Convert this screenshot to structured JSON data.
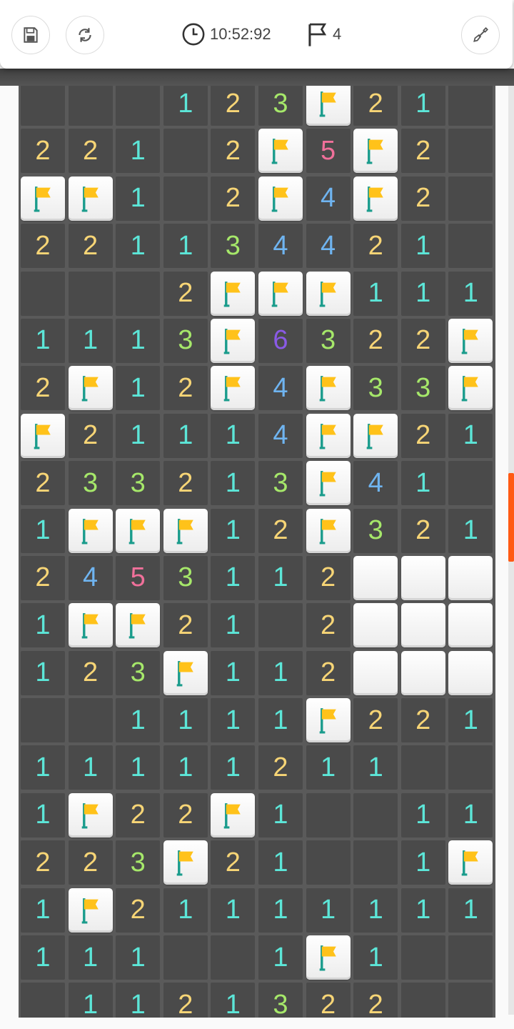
{
  "toolbar": {
    "save_icon": "save-icon",
    "restart_icon": "restart-icon",
    "timer": "10:52:92",
    "timer_icon": "clock-icon",
    "flag_count": "4",
    "flag_icon": "flag-outline-icon",
    "tool_icon": "shovel-icon"
  },
  "colors": {
    "1": "#5ce6d8",
    "2": "#f7d576",
    "3": "#a6e86a",
    "4": "#6fb4f0",
    "5": "#f0709a",
    "6": "#8a5ae6",
    "accent": "#ff5a14"
  },
  "board": {
    "rows": [
      [
        "",
        "",
        "",
        "1",
        "2",
        "3",
        "F",
        "2",
        "1",
        ""
      ],
      [
        "2",
        "2",
        "1",
        "",
        "2",
        "F",
        "5",
        "F",
        "2",
        ""
      ],
      [
        "F",
        "F",
        "1",
        "",
        "2",
        "F",
        "4",
        "F",
        "2",
        ""
      ],
      [
        "2",
        "2",
        "1",
        "1",
        "3",
        "4",
        "4",
        "2",
        "1",
        ""
      ],
      [
        "",
        "",
        "",
        "2",
        "F",
        "F",
        "F",
        "1",
        "1",
        "1"
      ],
      [
        "1",
        "1",
        "1",
        "3",
        "F",
        "6",
        "3",
        "2",
        "2",
        "F"
      ],
      [
        "2",
        "F",
        "1",
        "2",
        "F",
        "4",
        "F",
        "3",
        "3",
        "F"
      ],
      [
        "F",
        "2",
        "1",
        "1",
        "1",
        "4",
        "F",
        "F",
        "2",
        "1"
      ],
      [
        "2",
        "3",
        "3",
        "2",
        "1",
        "3",
        "F",
        "4",
        "1",
        ""
      ],
      [
        "1",
        "F",
        "F",
        "F",
        "1",
        "2",
        "F",
        "3",
        "2",
        "1"
      ],
      [
        "2",
        "4",
        "5",
        "3",
        "1",
        "1",
        "2",
        "H",
        "H",
        "H"
      ],
      [
        "1",
        "F",
        "F",
        "2",
        "1",
        "",
        "2",
        "H",
        "H",
        "H"
      ],
      [
        "1",
        "2",
        "3",
        "F",
        "1",
        "1",
        "2",
        "H",
        "H",
        "H"
      ],
      [
        "",
        "",
        "1",
        "1",
        "1",
        "1",
        "F",
        "2",
        "2",
        "1"
      ],
      [
        "1",
        "1",
        "1",
        "1",
        "1",
        "2",
        "1",
        "1",
        "",
        ""
      ],
      [
        "1",
        "F",
        "2",
        "2",
        "F",
        "1",
        "",
        "",
        "1",
        "1"
      ],
      [
        "2",
        "2",
        "3",
        "F",
        "2",
        "1",
        "",
        "",
        "1",
        "F"
      ],
      [
        "1",
        "F",
        "2",
        "1",
        "1",
        "1",
        "1",
        "1",
        "1",
        "1"
      ],
      [
        "1",
        "1",
        "1",
        "",
        "",
        "1",
        "F",
        "1",
        "",
        ""
      ],
      [
        "",
        "1",
        "1",
        "2",
        "1",
        "3",
        "2",
        "2",
        "",
        ""
      ]
    ]
  }
}
